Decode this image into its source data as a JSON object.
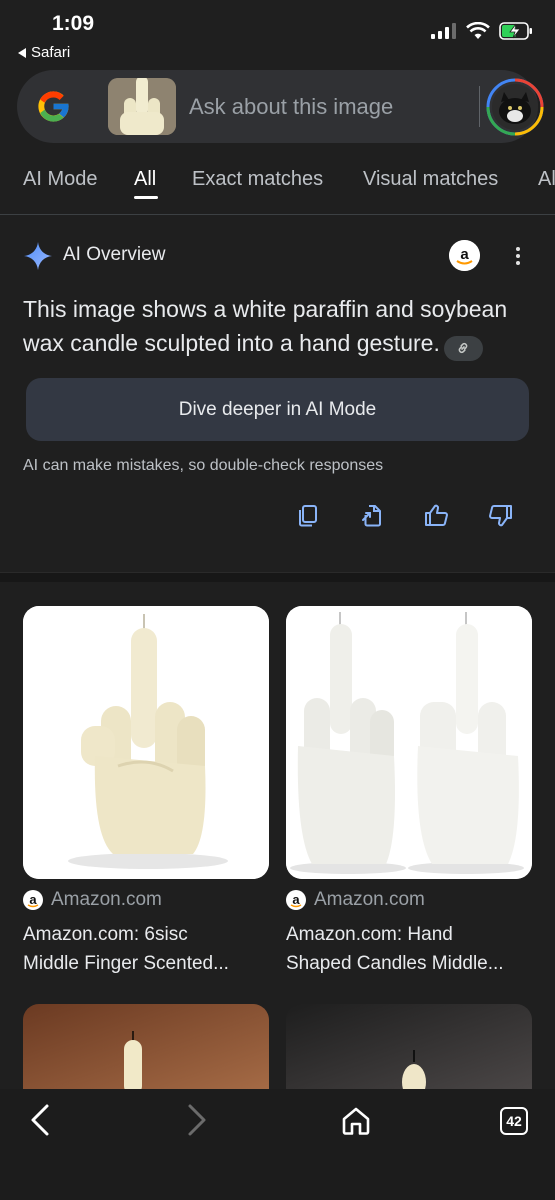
{
  "status_bar": {
    "time": "1:09",
    "back_app": "Safari",
    "icons": [
      "signal-icon",
      "wifi-icon",
      "battery-charging-icon"
    ]
  },
  "search": {
    "query_placeholder": "Ask about this image"
  },
  "tabs": [
    {
      "label": "AI Mode",
      "active": false
    },
    {
      "label": "All",
      "active": true
    },
    {
      "label": "Exact matches",
      "active": false
    },
    {
      "label": "Visual matches",
      "active": false
    },
    {
      "label": "Al",
      "active": false
    }
  ],
  "ai_overview": {
    "title": "AI Overview",
    "body": "This image shows a white paraffin and soybean wax candle sculpted into a hand gesture.",
    "dive_button": "Dive deeper in AI Mode",
    "disclaimer": "AI can make mistakes, so double-check responses",
    "actions": [
      "copy-icon",
      "export-icon",
      "thumbs-up-icon",
      "thumbs-down-icon"
    ]
  },
  "results": [
    {
      "source": "Amazon.com",
      "title_line1": "Amazon.com: 6sisc",
      "title_line2": "Middle Finger Scented..."
    },
    {
      "source": "Amazon.com",
      "title_line1": "Amazon.com: Hand",
      "title_line2": "Shaped Candles Middle..."
    }
  ],
  "toolbar": {
    "tab_count": "42",
    "icons": [
      "back-arrow-icon",
      "forward-arrow-icon",
      "home-icon",
      "tabs-icon"
    ]
  },
  "colors": {
    "background": "#1f1f1f",
    "surface": "#303134",
    "button": "#333843",
    "accent_blue": "#8ab4f8"
  }
}
